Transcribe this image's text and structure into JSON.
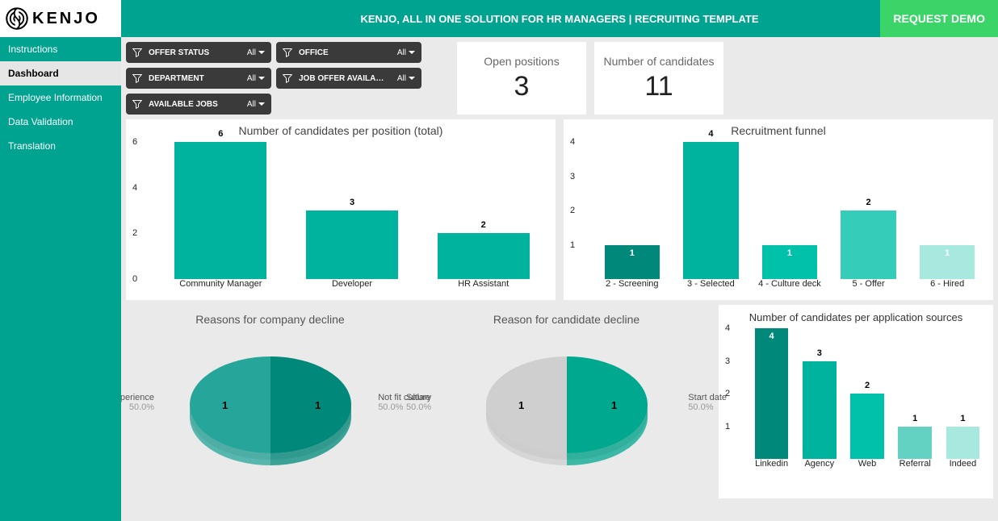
{
  "brand": "KENJO",
  "topbar": {
    "title": "KENJO, ALL IN ONE SOLUTION FOR HR MANAGERS | RECRUITING TEMPLATE",
    "cta": "REQUEST DEMO"
  },
  "nav": [
    {
      "label": "Instructions",
      "active": false
    },
    {
      "label": "Dashboard",
      "active": true
    },
    {
      "label": "Employee Information",
      "active": false
    },
    {
      "label": "Data Validation",
      "active": false
    },
    {
      "label": "Translation",
      "active": false
    }
  ],
  "filters": [
    {
      "label": "OFFER STATUS",
      "value": "All"
    },
    {
      "label": "OFFICE",
      "value": "All"
    },
    {
      "label": "DEPARTMENT",
      "value": "All"
    },
    {
      "label": "JOB OFFER AVAILABLE ...",
      "value": "All"
    },
    {
      "label": "AVAILABLE JOBS",
      "value": "All"
    }
  ],
  "kpis": [
    {
      "label": "Open positions",
      "value": "3"
    },
    {
      "label": "Number of candidates",
      "value": "11"
    }
  ],
  "chart_data": [
    {
      "id": "candidates_per_position",
      "type": "bar",
      "title": "Number of candidates per position (total)",
      "categories": [
        "Community Manager",
        "Developer",
        "HR Assistant"
      ],
      "values": [
        6,
        3,
        2
      ],
      "colors": [
        "#00b39e",
        "#00b39e",
        "#00b39e"
      ],
      "ylim": [
        0,
        6
      ],
      "yticks": [
        0,
        2,
        4,
        6
      ]
    },
    {
      "id": "recruitment_funnel",
      "type": "bar",
      "title": "Recruitment funnel",
      "categories": [
        "2 - Screening",
        "3 - Selected",
        "4 - Culture deck",
        "5 - Offer",
        "6 - Hired"
      ],
      "values": [
        1,
        4,
        1,
        2,
        1
      ],
      "colors": [
        "#00897b",
        "#00b39e",
        "#00c2aa",
        "#35cdba",
        "#a7e8df"
      ],
      "ylim": [
        0,
        4
      ],
      "yticks": [
        1,
        2,
        3,
        4
      ]
    },
    {
      "id": "reasons_company_decline",
      "type": "pie",
      "title": "Reasons for company decline",
      "slices": [
        {
          "label": "Experience",
          "value": 1,
          "pct": "50.0%",
          "color": "#26a69a"
        },
        {
          "label": "Not fit culture",
          "value": 1,
          "pct": "50.0%",
          "color": "#00897b"
        }
      ]
    },
    {
      "id": "reason_candidate_decline",
      "type": "pie",
      "title": "Reason for candidate decline",
      "slices": [
        {
          "label": "Salary",
          "value": 1,
          "pct": "50.0%",
          "color": "#cfcfcf"
        },
        {
          "label": "Start date",
          "value": 1,
          "pct": "50.0%",
          "color": "#00a88f"
        }
      ]
    },
    {
      "id": "candidates_per_source",
      "type": "bar",
      "title": "Number of candidates per application sources",
      "categories": [
        "Linkedin",
        "Agency",
        "Web",
        "Referral",
        "Indeed"
      ],
      "values": [
        4,
        3,
        2,
        1,
        1
      ],
      "colors": [
        "#00897b",
        "#00b39e",
        "#00c2aa",
        "#63d2c3",
        "#a7e8df"
      ],
      "ylim": [
        0,
        4
      ],
      "yticks": [
        1,
        2,
        3,
        4
      ]
    }
  ]
}
